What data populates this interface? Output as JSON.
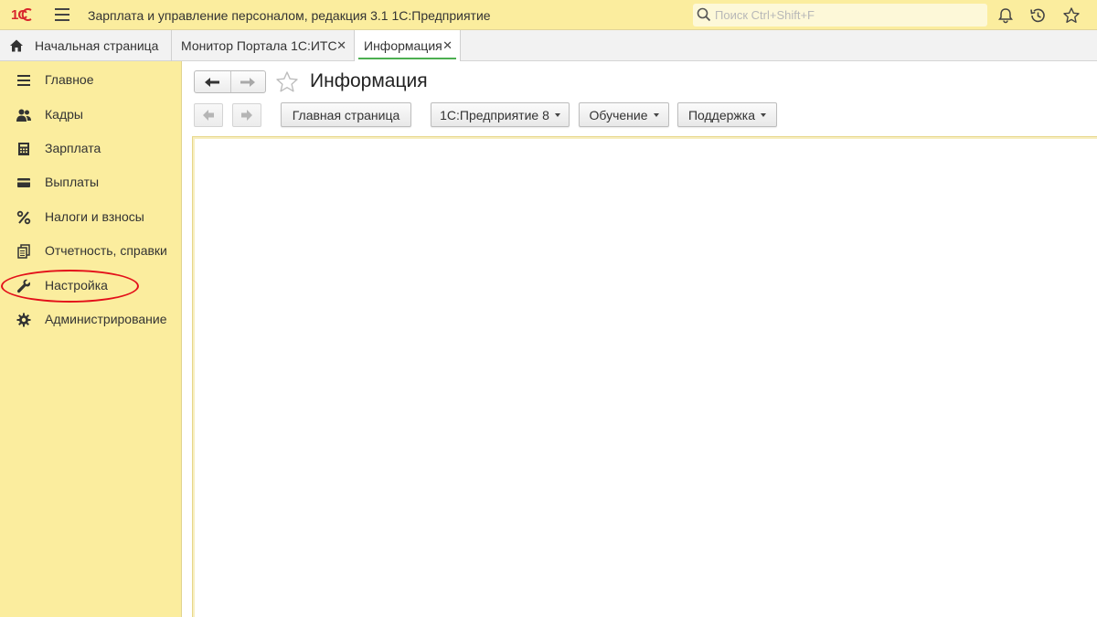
{
  "titlebar": {
    "logo": "1С",
    "app_title": "Зарплата и управление персоналом, редакция 3.1 1С:Предприятие",
    "search_placeholder": "Поиск Ctrl+Shift+F"
  },
  "tabs": [
    {
      "label": "Начальная страница"
    },
    {
      "label": "Монитор Портала 1С:ИТС"
    },
    {
      "label": "Информация"
    }
  ],
  "tab_close": "✕",
  "sidebar": {
    "items": [
      {
        "label": "Главное",
        "icon": "list-icon"
      },
      {
        "label": "Кадры",
        "icon": "people-icon"
      },
      {
        "label": "Зарплата",
        "icon": "calculator-icon"
      },
      {
        "label": "Выплаты",
        "icon": "wallet-icon"
      },
      {
        "label": "Налоги и взносы",
        "icon": "percent-icon"
      },
      {
        "label": "Отчетность, справки",
        "icon": "documents-icon"
      },
      {
        "label": "Настройка",
        "icon": "wrench-icon"
      },
      {
        "label": "Администрирование",
        "icon": "gear-icon"
      }
    ],
    "highlighted": "Настройка"
  },
  "main": {
    "title": "Информация",
    "toolbar": {
      "home_page": "Главная страница",
      "enterprise": "1С:Предприятие 8",
      "training": "Обучение",
      "support": "Поддержка"
    }
  },
  "colors": {
    "accent_yellow": "#fbed9e",
    "logo_red": "#d8262c",
    "active_tab_underline": "#4caf50",
    "highlight_ellipse": "#e3101a"
  }
}
